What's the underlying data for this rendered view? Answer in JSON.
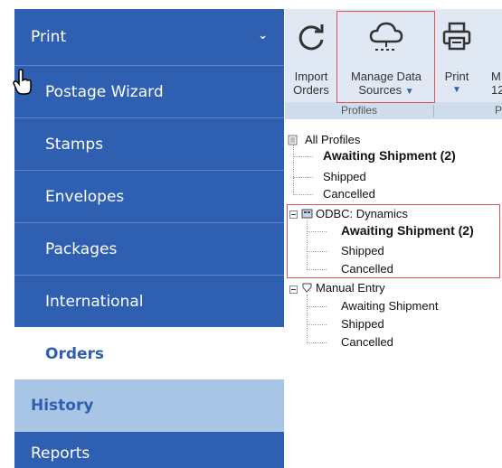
{
  "sidebar": {
    "print_label": "Print",
    "items": [
      {
        "label": "Postage Wizard"
      },
      {
        "label": "Stamps"
      },
      {
        "label": "Envelopes"
      },
      {
        "label": "Packages"
      },
      {
        "label": "International"
      },
      {
        "label": "Orders"
      }
    ],
    "history_label": "History",
    "reports_label": "Reports"
  },
  "ribbon": {
    "import": {
      "line1": "Import",
      "line2": "Orders"
    },
    "manage": {
      "line1": "Manage Data",
      "line2": "Sources"
    },
    "print": {
      "line1": "Print"
    },
    "more": {
      "line1": "M",
      "line2": "12"
    },
    "groups": {
      "profiles": "Profiles",
      "partial": "P"
    }
  },
  "tree": {
    "all_profiles": "All Profiles",
    "all_awaiting": "Awaiting Shipment (2)",
    "all_shipped": "Shipped",
    "all_cancelled": "Cancelled",
    "odbc": "ODBC: Dynamics",
    "odbc_awaiting": "Awaiting Shipment (2)",
    "odbc_shipped": "Shipped",
    "odbc_cancelled": "Cancelled",
    "manual": "Manual Entry",
    "manual_awaiting": "Awaiting Shipment",
    "manual_shipped": "Shipped",
    "manual_cancelled": "Cancelled"
  },
  "colors": {
    "sidebar_blue": "#2f5fb1",
    "history_bg": "#a9c5e6",
    "ribbon_bg": "#dfe8f3",
    "highlight": "#e0515a"
  }
}
